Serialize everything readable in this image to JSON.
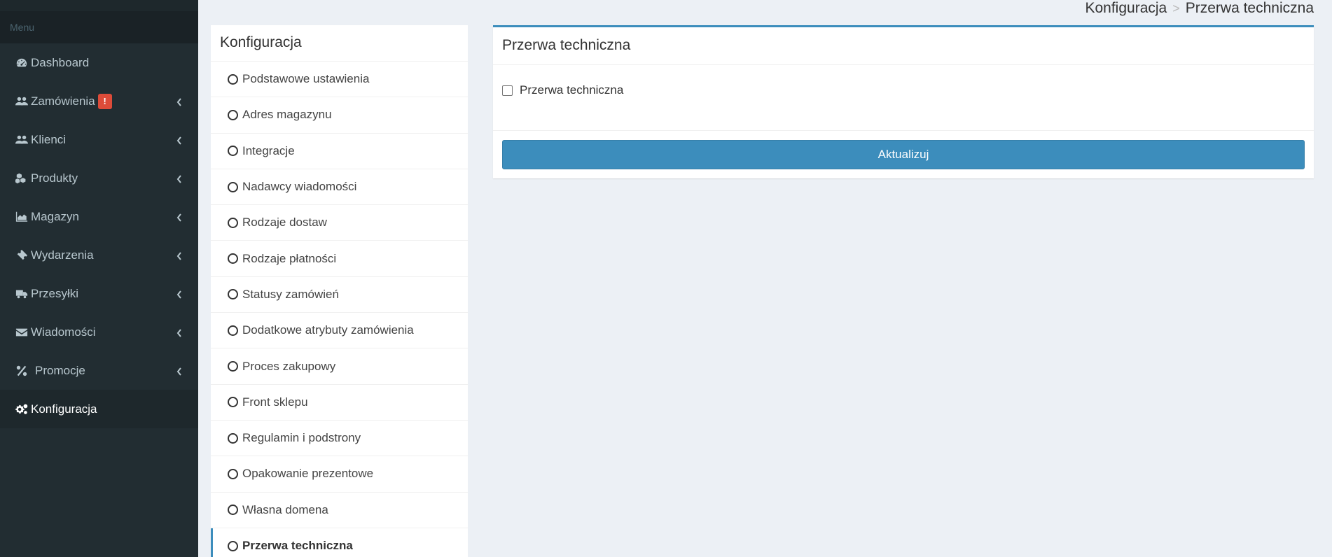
{
  "sidebar": {
    "header": "Menu",
    "items": [
      {
        "label": "Dashboard",
        "icon": "dashboard-icon",
        "has_chevron": false
      },
      {
        "label": "Zamówienia",
        "icon": "users-icon",
        "has_chevron": true,
        "badge": "!"
      },
      {
        "label": "Klienci",
        "icon": "users-icon",
        "has_chevron": true
      },
      {
        "label": "Produkty",
        "icon": "cubes-icon",
        "has_chevron": true
      },
      {
        "label": "Magazyn",
        "icon": "area-chart-icon",
        "has_chevron": true
      },
      {
        "label": "Wydarzenia",
        "icon": "ticket-icon",
        "has_chevron": true
      },
      {
        "label": "Przesyłki",
        "icon": "truck-icon",
        "has_chevron": true
      },
      {
        "label": "Wiadomości",
        "icon": "envelope-icon",
        "has_chevron": true
      },
      {
        "label": "Promocje",
        "icon": "percent-icon",
        "has_chevron": true
      },
      {
        "label": "Konfiguracja",
        "icon": "cogs-icon",
        "has_chevron": false,
        "active": true
      }
    ]
  },
  "breadcrumb": {
    "parent": "Konfiguracja",
    "separator": ">",
    "current": "Przerwa techniczna"
  },
  "config_panel": {
    "title": "Konfiguracja",
    "items": [
      "Podstawowe ustawienia",
      "Adres magazynu",
      "Integracje",
      "Nadawcy wiadomości",
      "Rodzaje dostaw",
      "Rodzaje płatności",
      "Statusy zamówień",
      "Dodatkowe atrybuty zamówienia",
      "Proces zakupowy",
      "Front sklepu",
      "Regulamin i podstrony",
      "Opakowanie prezentowe",
      "Własna domena",
      "Przerwa techniczna"
    ],
    "active_item": "Przerwa techniczna"
  },
  "main_panel": {
    "title": "Przerwa techniczna",
    "checkbox_label": "Przerwa techniczna",
    "checkbox_checked": false,
    "submit_label": "Aktualizuj"
  },
  "colors": {
    "sidebar_bg": "#222d32",
    "accent": "#3c8dbc",
    "badge": "#dd4b39",
    "page_bg": "#ecf0f5"
  }
}
